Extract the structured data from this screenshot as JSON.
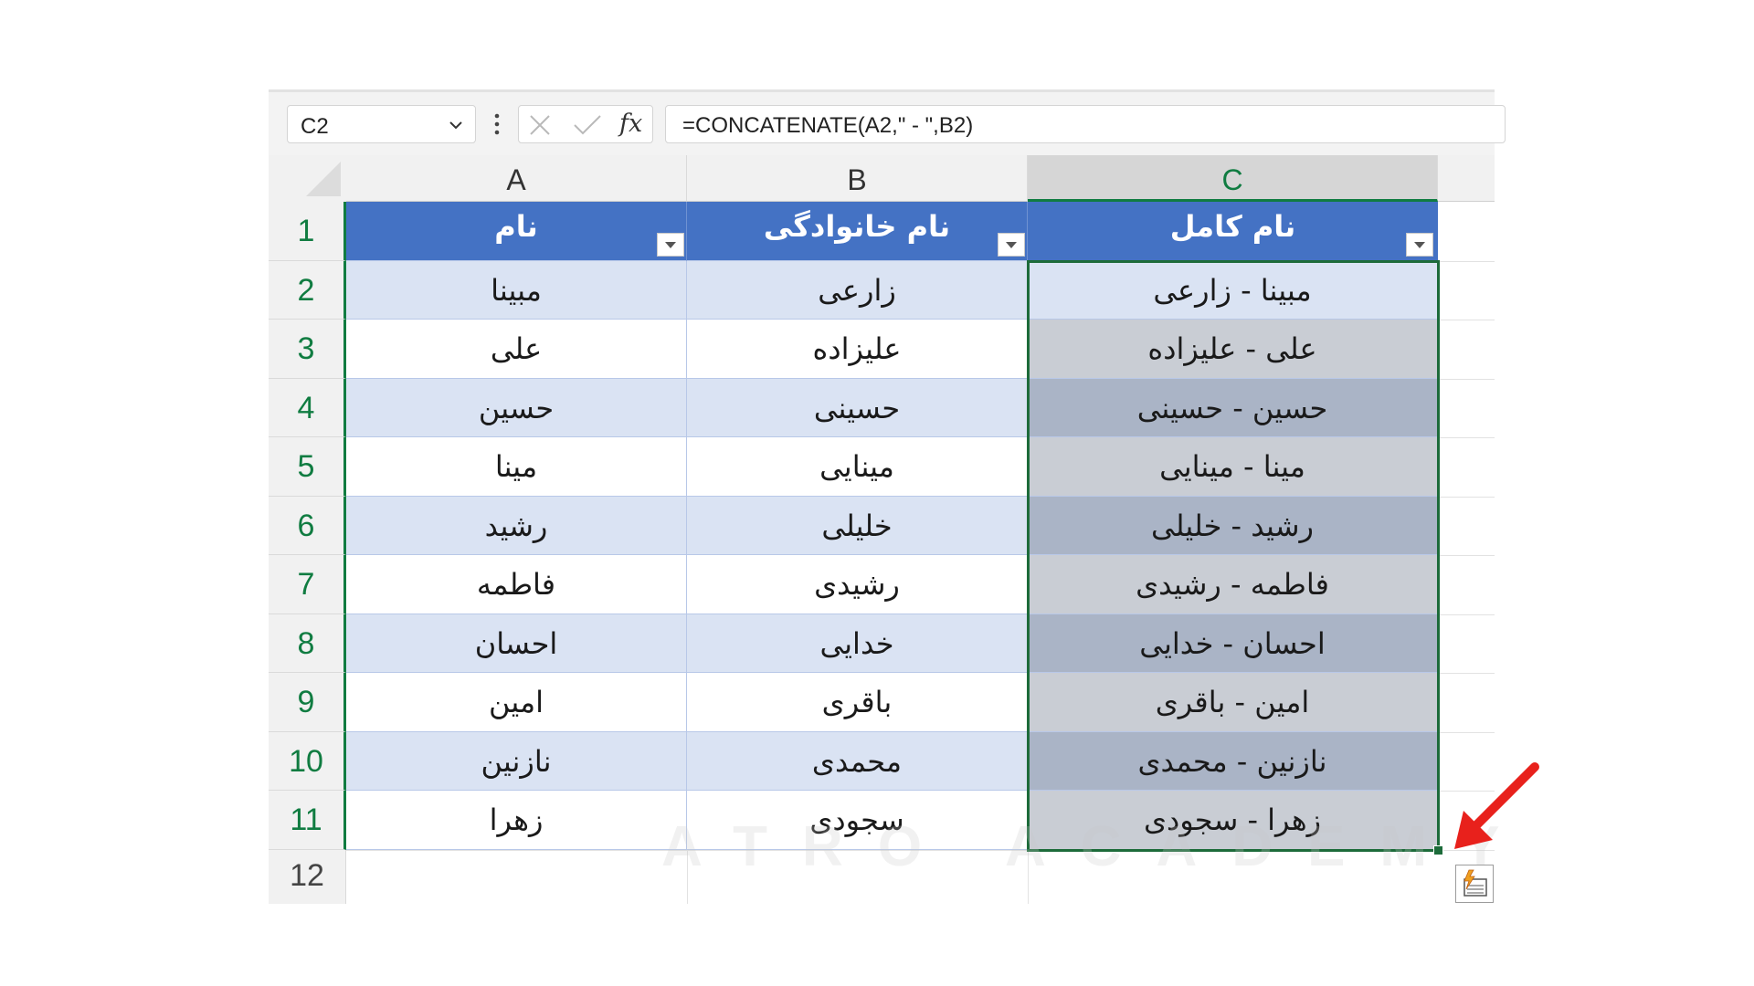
{
  "name_box": {
    "value": "C2"
  },
  "formula_bar": {
    "formula": "=CONCATENATE(A2,\" - \",B2)",
    "fx_label": "fx"
  },
  "columns": [
    {
      "letter": "A"
    },
    {
      "letter": "B"
    },
    {
      "letter": "C"
    }
  ],
  "rows": [
    "1",
    "2",
    "3",
    "4",
    "5",
    "6",
    "7",
    "8",
    "9",
    "10",
    "11",
    "12"
  ],
  "table": {
    "headers": [
      "نام",
      "نام خانوادگی",
      "نام کامل"
    ],
    "data": [
      [
        "مبینا",
        "زارعی",
        "مبینا - زارعی"
      ],
      [
        "علی",
        "علیزاده",
        "علی - علیزاده"
      ],
      [
        "حسین",
        "حسینی",
        "حسین - حسینی"
      ],
      [
        "مینا",
        "مینایی",
        "مینا - مینایی"
      ],
      [
        "رشید",
        "خلیلی",
        "رشید - خلیلی"
      ],
      [
        "فاطمه",
        "رشیدی",
        "فاطمه - رشیدی"
      ],
      [
        "احسان",
        "خدایی",
        "احسان - خدایی"
      ],
      [
        "امین",
        "باقری",
        "امین - باقری"
      ],
      [
        "نازنین",
        "محمدی",
        "نازنین - محمدی"
      ],
      [
        "زهرا",
        "سجودی",
        "زهرا - سجودی"
      ]
    ]
  },
  "watermark": "ATRO ACADEMY",
  "colors": {
    "header_blue": "#4472c4",
    "band_blue": "#dae3f3",
    "selection_green": "#107c41",
    "arrow_red": "#e8211c"
  }
}
